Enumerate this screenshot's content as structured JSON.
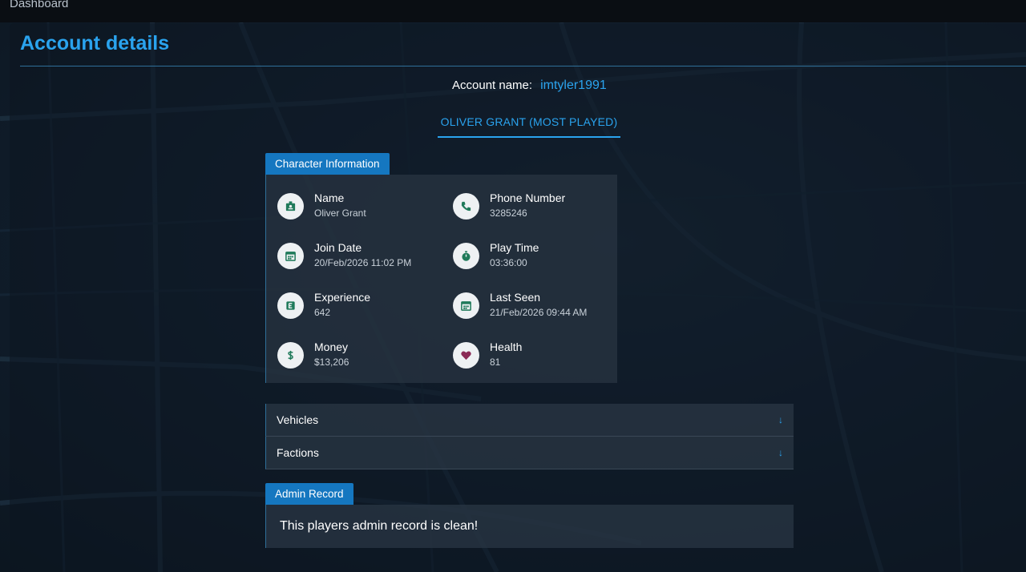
{
  "topbar": {
    "breadcrumb": "Dashboard"
  },
  "header": {
    "title": "Account details"
  },
  "account": {
    "label": "Account name:",
    "value": "imtyler1991"
  },
  "character_tab": {
    "label": "OLIVER GRANT (MOST PLAYED)"
  },
  "character_info": {
    "section_label": "Character Information",
    "items": [
      {
        "title": "Name",
        "value": "Oliver Grant",
        "icon": "id-badge-icon"
      },
      {
        "title": "Phone Number",
        "value": "3285246",
        "icon": "phone-icon"
      },
      {
        "title": "Join Date",
        "value": "20/Feb/2026 11:02 PM",
        "icon": "calendar-icon"
      },
      {
        "title": "Play Time",
        "value": "03:36:00",
        "icon": "stopwatch-icon"
      },
      {
        "title": "Experience",
        "value": "642",
        "icon": "experience-icon"
      },
      {
        "title": "Last Seen",
        "value": "21/Feb/2026 09:44 AM",
        "icon": "calendar-icon"
      },
      {
        "title": "Money",
        "value": "$13,206",
        "icon": "dollar-icon"
      },
      {
        "title": "Health",
        "value": "81",
        "icon": "heart-icon"
      }
    ]
  },
  "accordions": [
    {
      "label": "Vehicles",
      "icon": "arrow-down-icon"
    },
    {
      "label": "Factions",
      "icon": "arrow-down-icon"
    }
  ],
  "admin_record": {
    "section_label": "Admin Record",
    "message": "This players admin record is clean!"
  },
  "colors": {
    "accent": "#2aa3ee",
    "section_tab": "#1577c0",
    "icon_green": "#1f7a5a",
    "heart": "#8b2a55"
  }
}
